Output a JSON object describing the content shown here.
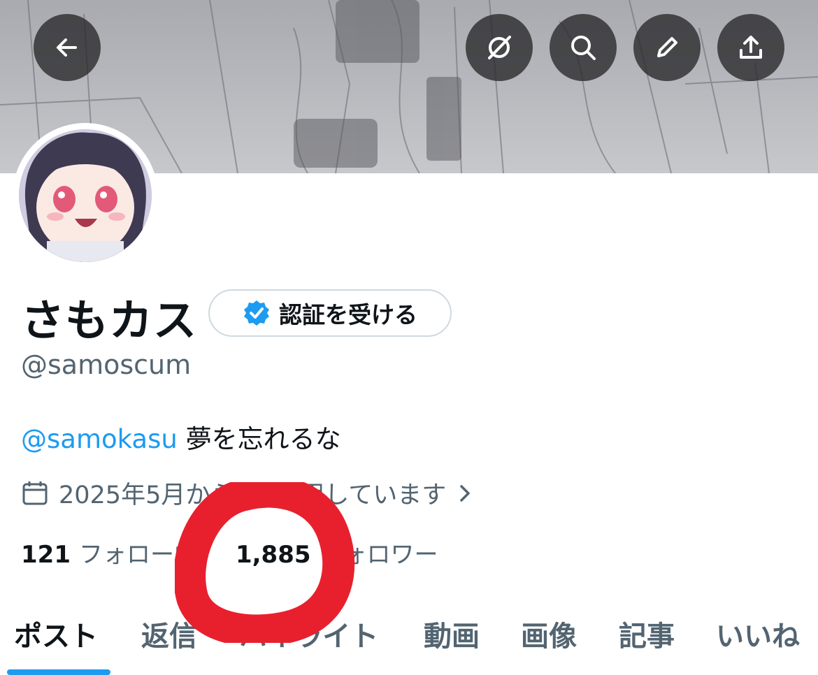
{
  "header": {
    "back_icon": "arrow-left-icon",
    "actions": [
      "grok-icon",
      "search-icon",
      "edit-icon",
      "share-icon"
    ]
  },
  "profile": {
    "display_name": "さもカス",
    "verify_button_label": "認証を受ける",
    "handle": "@samoscum",
    "bio": {
      "mention": "@samokasu",
      "text": "夢を忘れるな"
    },
    "joined_text": "2025年5月からXを利用しています",
    "following_count": "121",
    "following_label": "フォロー中",
    "followers_count": "1,885",
    "followers_label": "フォロワー"
  },
  "tabs": [
    {
      "label": "ポスト",
      "active": true
    },
    {
      "label": "返信",
      "active": false
    },
    {
      "label": "ハイライト",
      "active": false
    },
    {
      "label": "動画",
      "active": false
    },
    {
      "label": "画像",
      "active": false
    },
    {
      "label": "記事",
      "active": false
    },
    {
      "label": "いいね",
      "active": false
    }
  ],
  "colors": {
    "accent": "#1d9bf0",
    "secondary_text": "#536471",
    "annotation": "#e8202e"
  }
}
